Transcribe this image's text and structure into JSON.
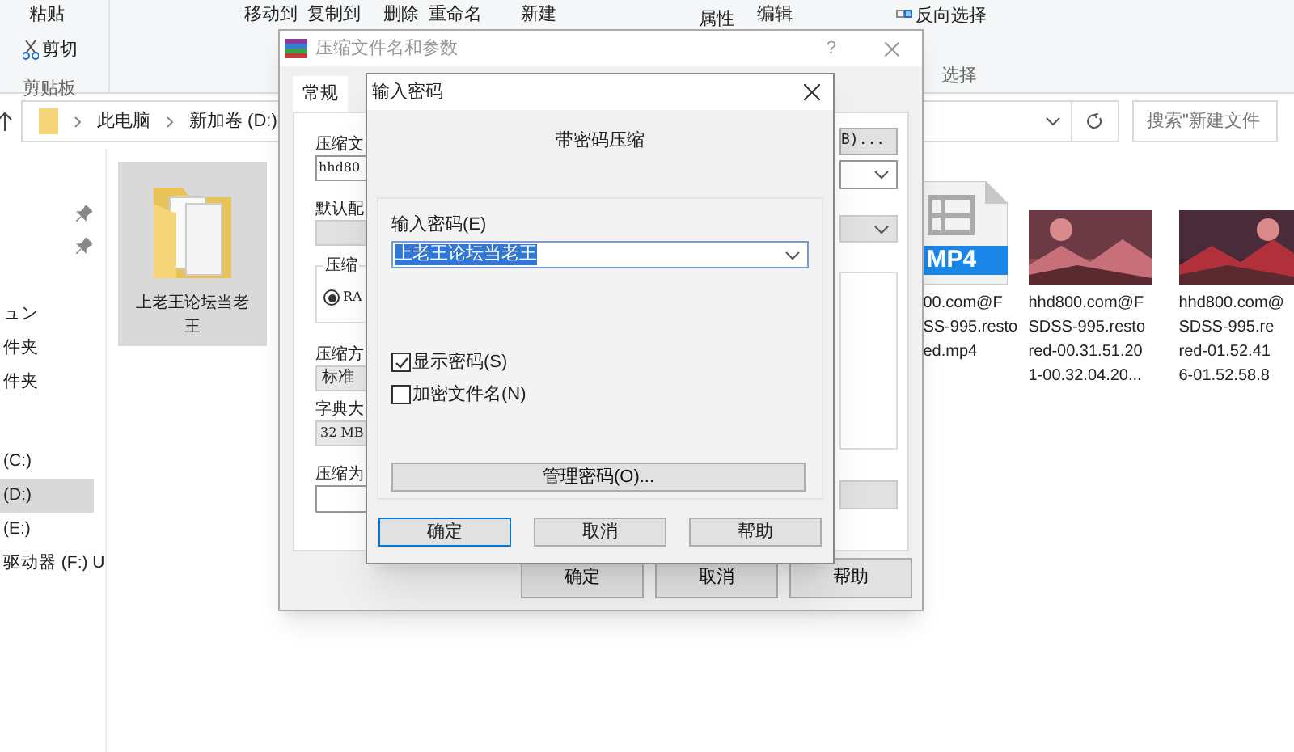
{
  "ribbon": {
    "paste": "粘贴",
    "cut": "剪切",
    "clipboard_group": "剪贴板",
    "organize": [
      "移动到",
      "复制到",
      "删除",
      "重命名"
    ],
    "new": "新建",
    "open": [
      "属性",
      "编辑"
    ],
    "select": [
      "反向选择",
      "选择"
    ]
  },
  "address": {
    "crumbs": [
      "此电脑",
      "新加卷 (D:)"
    ],
    "search_placeholder": "搜索\"新建文件"
  },
  "nav": [
    {
      "kind": "pinned"
    },
    {
      "kind": "pinned"
    },
    {
      "kind": "entry",
      "label": "ュン",
      "selected": false
    },
    {
      "kind": "entry",
      "label": "件夹",
      "selected": false
    },
    {
      "kind": "entry",
      "label": "件夹",
      "selected": false
    },
    {
      "kind": "entry",
      "label": "(C:)",
      "selected": false
    },
    {
      "kind": "entry",
      "label": "(D:)",
      "selected": true
    },
    {
      "kind": "entry",
      "label": "(E:)",
      "selected": false
    },
    {
      "kind": "entry",
      "label": "驱动器 (F:) U",
      "selected": false
    }
  ],
  "files": [
    {
      "kind": "folder",
      "lines": [
        "上老王论坛当老",
        "王"
      ],
      "selected": true
    },
    {
      "kind": "video",
      "badge": "MP4",
      "lines": [
        "00.com@F",
        "SS-995.resto",
        "ed.mp4"
      ],
      "selected": false
    },
    {
      "kind": "picture",
      "lines": [
        "hhd800.com@F",
        "SDSS-995.resto",
        "red-00.31.51.20",
        "1-00.32.04.20..."
      ],
      "selected": false
    },
    {
      "kind": "picture",
      "lines": [
        "hhd800.com@",
        "SDSS-995.re",
        "red-01.52.41",
        "6-01.52.58.8"
      ],
      "selected": false
    }
  ],
  "archive_dialog": {
    "title": "压缩文件名和参数",
    "help": "?",
    "tabs": [
      {
        "label": "常规",
        "selected": true
      }
    ],
    "name_label": "压缩文",
    "name_value": "hhd80",
    "profile_label": "默认配",
    "format_group": "压缩",
    "format_option": {
      "label": "RA",
      "selected": true
    },
    "method_label": "压缩方",
    "method_value": "标准",
    "dict_label": "字典大",
    "dict_value": "32 MB",
    "split_label": "压缩为",
    "browse_button": "B)...",
    "buttons": [
      "确定",
      "取消",
      "帮助"
    ]
  },
  "password_dialog": {
    "title": "输入密码",
    "heading": "带密码压缩",
    "field_label": "输入密码(E)",
    "value": "上老王论坛当老王",
    "options": [
      {
        "label": "显示密码(S)",
        "checked": true
      },
      {
        "label": "加密文件名(N)",
        "checked": false
      }
    ],
    "manage_button": "管理密码(O)...",
    "buttons": [
      {
        "label": "确定",
        "focused": true
      },
      {
        "label": "取消",
        "focused": false
      },
      {
        "label": "帮助",
        "focused": false
      }
    ]
  }
}
